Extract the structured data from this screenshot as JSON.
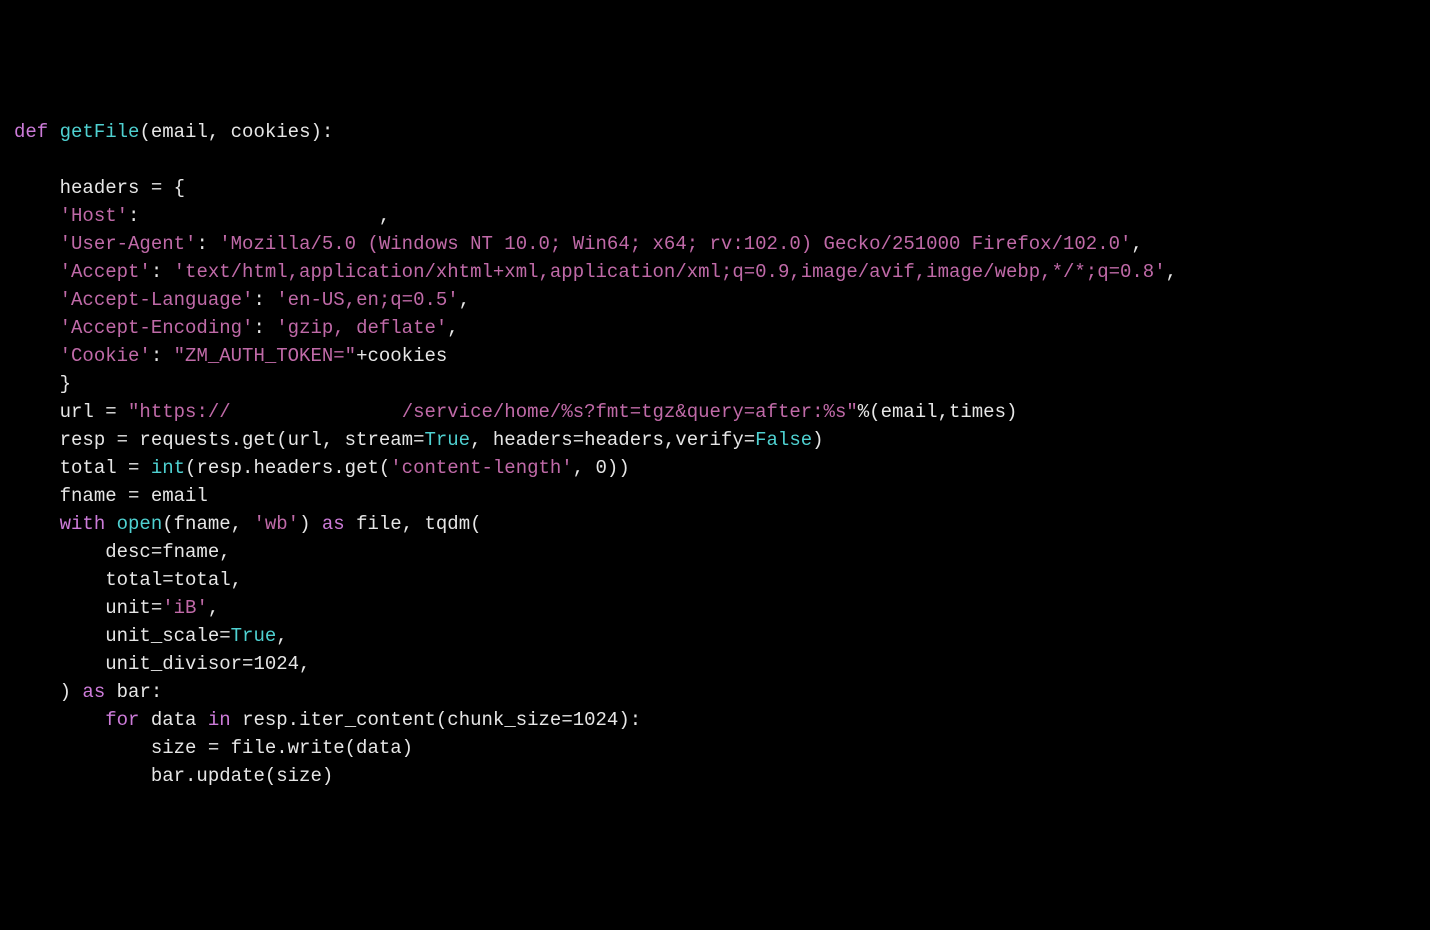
{
  "code": {
    "l01": {
      "def": "def ",
      "fn": "getFile",
      "rest": "(email, cookies):"
    },
    "l02": "",
    "l03": "    headers = {",
    "l04": {
      "key": "    'Host'",
      "colon": ":",
      "pad": "                     ",
      "comma": ","
    },
    "l05": {
      "key": "    'User-Agent'",
      "colon": ": ",
      "val": "'Mozilla/5.0 (Windows NT 10.0; Win64; x64; rv:102.0) Gecko/251000 Firefox/102.0'",
      "comma": ","
    },
    "l06": {
      "key": "    'Accept'",
      "colon": ": ",
      "val": "'text/html,application/xhtml+xml,application/xml;q=0.9,image/avif,image/webp,*/*;q=0.8'",
      "comma": ","
    },
    "l07": {
      "key": "    'Accept-Language'",
      "colon": ": ",
      "val": "'en-US,en;q=0.5'",
      "comma": ","
    },
    "l08": {
      "key": "    'Accept-Encoding'",
      "colon": ": ",
      "val": "'gzip, deflate'",
      "comma": ","
    },
    "l09": {
      "key": "    'Cookie'",
      "colon": ": ",
      "val": "\"ZM_AUTH_TOKEN=\"",
      "plus": "+cookies"
    },
    "l10": "    }",
    "l11": {
      "pre": "    url = ",
      "s1": "\"https://",
      "gap": "               ",
      "s2": "/service/home/%s?fmt=tgz&query=after:%s\"",
      "post": "%(email,times)"
    },
    "l12": {
      "pre": "    resp = requests.get(url, stream=",
      "t1": "True",
      "mid": ", headers=headers,verify=",
      "t2": "False",
      "post": ")"
    },
    "l13": {
      "pre": "    total = ",
      "fn": "int",
      "mid": "(resp.headers.get(",
      "s": "'content-length'",
      "post": ", 0))"
    },
    "l14": "    fname = email",
    "l15": {
      "pre": "    ",
      "kw1": "with",
      "sp1": " ",
      "fn": "open",
      "mid1": "(fname, ",
      "s": "'wb'",
      "mid2": ") ",
      "kw2": "as",
      "post": " file, tqdm("
    },
    "l16": "        desc=fname,",
    "l17": "        total=total,",
    "l18": {
      "pre": "        unit=",
      "s": "'iB'",
      "post": ","
    },
    "l19": {
      "pre": "        unit_scale=",
      "t": "True",
      "post": ","
    },
    "l20": "        unit_divisor=1024,",
    "l21": {
      "pre": "    ) ",
      "kw": "as",
      "post": " bar:"
    },
    "l22": {
      "pre": "        ",
      "kw1": "for",
      "mid1": " data ",
      "kw2": "in",
      "post": " resp.iter_content(chunk_size=1024):"
    },
    "l23": "            size = file.write(data)",
    "l24": "            bar.update(size)"
  }
}
